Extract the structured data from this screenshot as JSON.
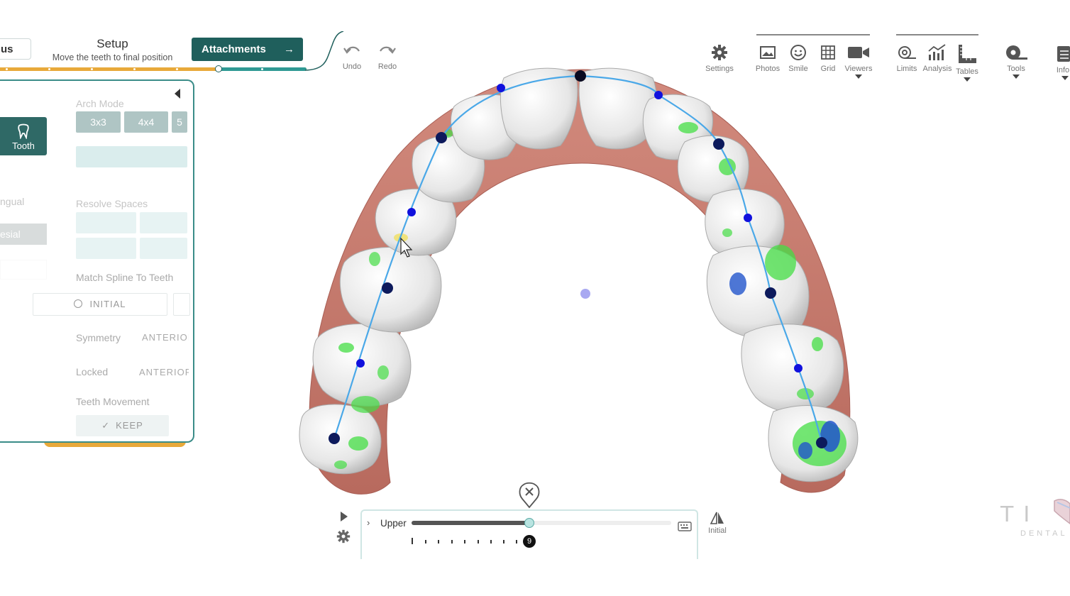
{
  "workflow": {
    "prev_label": "us",
    "step_title": "Setup",
    "step_subtitle": "Move the teeth to final position",
    "next_label": "Attachments",
    "next_arrow": "→"
  },
  "history": {
    "undo_label": "Undo",
    "redo_label": "Redo"
  },
  "toolbar": {
    "items": [
      {
        "label": "Settings",
        "icon": "gear-icon"
      },
      {
        "label": "Photos",
        "icon": "image-icon"
      },
      {
        "label": "Smile",
        "icon": "smile-icon"
      },
      {
        "label": "Grid",
        "icon": "grid-icon"
      },
      {
        "label": "Viewers",
        "icon": "video-camera-icon"
      },
      {
        "label": "Limits",
        "icon": "limits-icon"
      },
      {
        "label": "Analysis",
        "icon": "chart-icon"
      },
      {
        "label": "Tables",
        "icon": "ruler-icon"
      },
      {
        "label": "Tools",
        "icon": "tape-icon"
      },
      {
        "label": "Info",
        "icon": "clipboard-icon"
      }
    ]
  },
  "panel": {
    "tooth_label": "Tooth",
    "lingual_label": "ngual",
    "mesial_label": "esial",
    "arch_mode_label": "Arch Mode",
    "arch_modes": [
      "3x3",
      "4x4",
      "5"
    ],
    "resolve_spaces_label": "Resolve Spaces",
    "match_spline_label": "Match Spline To Teeth",
    "initial_label": "INITIAL",
    "symmetry_label": "Symmetry",
    "symmetry_value": "ANTERIOI",
    "locked_label": "Locked",
    "locked_value": "ANTERIOR",
    "teeth_movement_label": "Teeth Movement",
    "keep_label": "KEEP"
  },
  "timeline": {
    "jaw_label": "Upper",
    "current_step": "9",
    "initial_label": "Initial",
    "progress": 0.45
  },
  "brand": {
    "logo_text": "TI",
    "logo_sub": "DENTAL"
  },
  "colors": {
    "accent_dark": "#1f5f5c",
    "accent_teal": "#2f9a94",
    "progress_orange": "#e8a93a",
    "spline_blue": "#4aa8e8",
    "gum": "#c97b6e",
    "contact_green": "#44dd44"
  }
}
